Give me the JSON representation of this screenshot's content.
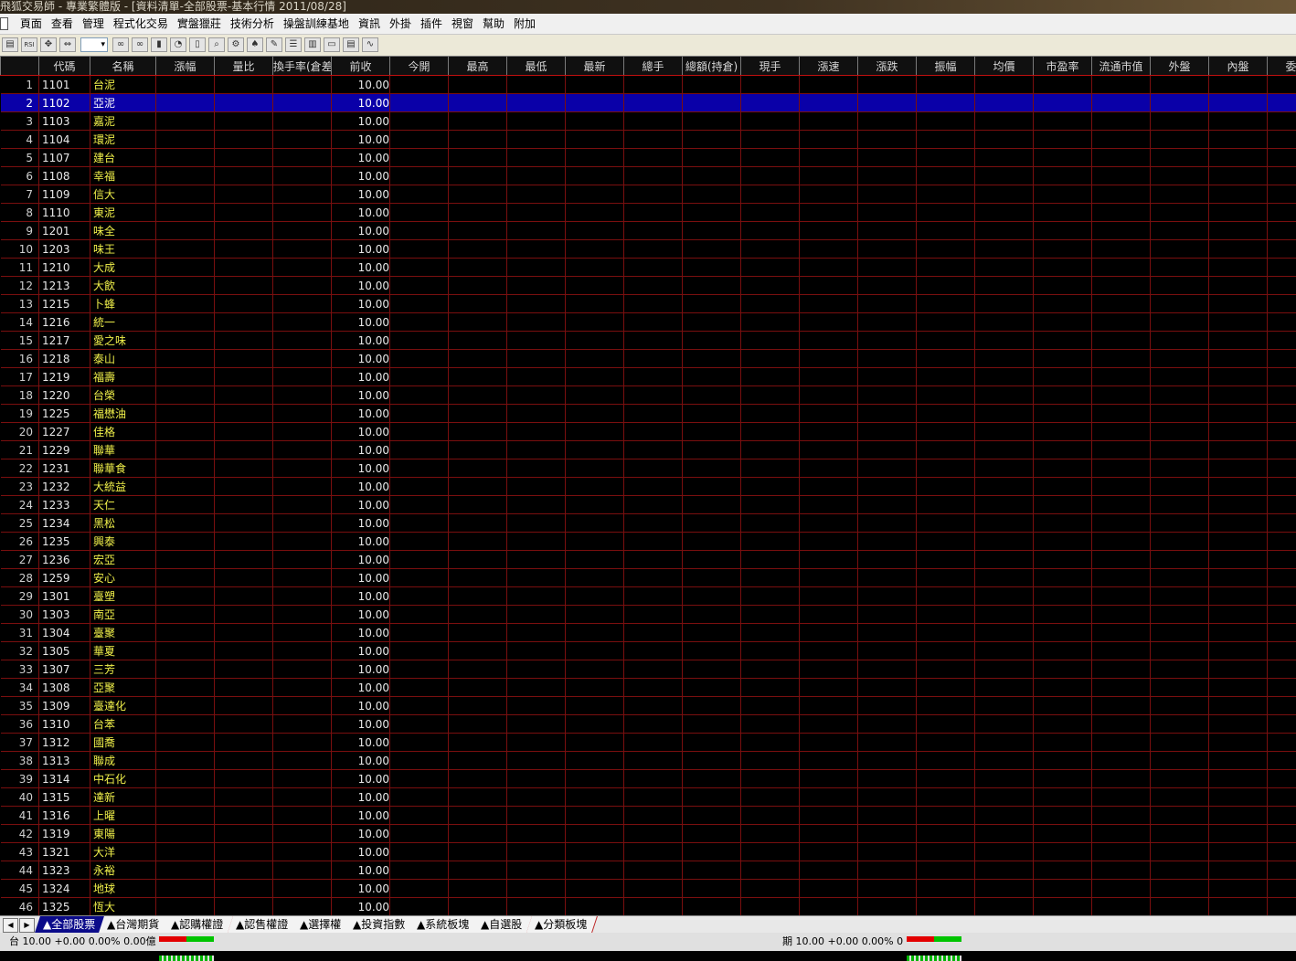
{
  "window": {
    "title": "飛狐交易師 - 專業繁體版 - [資料清單-全部股票-基本行情 2011/08/28]"
  },
  "menu": [
    "頁面",
    "查看",
    "管理",
    "程式化交易",
    "實盤獵莊",
    "技術分析",
    "操盤訓練基地",
    "資訊",
    "外掛",
    "插件",
    "視窗",
    "幫助",
    "附加"
  ],
  "toolbar": {
    "icons": [
      "folder-icon",
      "rsi-icon",
      "move-icon",
      "resize-icon",
      "binoculars-icon",
      "binoculars-2-icon",
      "bar-chart-icon",
      "pie-chart-icon",
      "book-icon",
      "search-icon",
      "gear-icon",
      "alarm-icon",
      "pen-icon",
      "layout-rows-icon",
      "layout-cols-icon",
      "window-icon",
      "list-window-icon",
      "graph-window-icon"
    ],
    "rsi_label": "RSI"
  },
  "table": {
    "columns": [
      "",
      "代碼",
      "名稱",
      "漲幅",
      "量比",
      "換手率(倉差)",
      "前收",
      "今開",
      "最高",
      "最低",
      "最新",
      "總手",
      "總額(持倉)",
      "現手",
      "漲速",
      "漲跌",
      "振幅",
      "均價",
      "市盈率",
      "流通市值",
      "外盤",
      "內盤",
      "委買"
    ],
    "selected_row": 2,
    "rows": [
      {
        "n": "1",
        "code": "1101",
        "name": "台泥",
        "prev": "10.00"
      },
      {
        "n": "2",
        "code": "1102",
        "name": "亞泥",
        "prev": "10.00"
      },
      {
        "n": "3",
        "code": "1103",
        "name": "嘉泥",
        "prev": "10.00"
      },
      {
        "n": "4",
        "code": "1104",
        "name": "環泥",
        "prev": "10.00"
      },
      {
        "n": "5",
        "code": "1107",
        "name": "建台",
        "prev": "10.00"
      },
      {
        "n": "6",
        "code": "1108",
        "name": "幸福",
        "prev": "10.00"
      },
      {
        "n": "7",
        "code": "1109",
        "name": "信大",
        "prev": "10.00"
      },
      {
        "n": "8",
        "code": "1110",
        "name": "東泥",
        "prev": "10.00"
      },
      {
        "n": "9",
        "code": "1201",
        "name": "味全",
        "prev": "10.00"
      },
      {
        "n": "10",
        "code": "1203",
        "name": "味王",
        "prev": "10.00"
      },
      {
        "n": "11",
        "code": "1210",
        "name": "大成",
        "prev": "10.00"
      },
      {
        "n": "12",
        "code": "1213",
        "name": "大飲",
        "prev": "10.00"
      },
      {
        "n": "13",
        "code": "1215",
        "name": "卜蜂",
        "prev": "10.00"
      },
      {
        "n": "14",
        "code": "1216",
        "name": "統一",
        "prev": "10.00"
      },
      {
        "n": "15",
        "code": "1217",
        "name": "愛之味",
        "prev": "10.00"
      },
      {
        "n": "16",
        "code": "1218",
        "name": "泰山",
        "prev": "10.00"
      },
      {
        "n": "17",
        "code": "1219",
        "name": "福壽",
        "prev": "10.00"
      },
      {
        "n": "18",
        "code": "1220",
        "name": "台榮",
        "prev": "10.00"
      },
      {
        "n": "19",
        "code": "1225",
        "name": "福懋油",
        "prev": "10.00"
      },
      {
        "n": "20",
        "code": "1227",
        "name": "佳格",
        "prev": "10.00"
      },
      {
        "n": "21",
        "code": "1229",
        "name": "聯華",
        "prev": "10.00"
      },
      {
        "n": "22",
        "code": "1231",
        "name": "聯華食",
        "prev": "10.00"
      },
      {
        "n": "23",
        "code": "1232",
        "name": "大統益",
        "prev": "10.00"
      },
      {
        "n": "24",
        "code": "1233",
        "name": "天仁",
        "prev": "10.00"
      },
      {
        "n": "25",
        "code": "1234",
        "name": "黑松",
        "prev": "10.00"
      },
      {
        "n": "26",
        "code": "1235",
        "name": "興泰",
        "prev": "10.00"
      },
      {
        "n": "27",
        "code": "1236",
        "name": "宏亞",
        "prev": "10.00"
      },
      {
        "n": "28",
        "code": "1259",
        "name": "安心",
        "prev": "10.00"
      },
      {
        "n": "29",
        "code": "1301",
        "name": "臺塑",
        "prev": "10.00"
      },
      {
        "n": "30",
        "code": "1303",
        "name": "南亞",
        "prev": "10.00"
      },
      {
        "n": "31",
        "code": "1304",
        "name": "臺聚",
        "prev": "10.00"
      },
      {
        "n": "32",
        "code": "1305",
        "name": "華夏",
        "prev": "10.00"
      },
      {
        "n": "33",
        "code": "1307",
        "name": "三芳",
        "prev": "10.00"
      },
      {
        "n": "34",
        "code": "1308",
        "name": "亞聚",
        "prev": "10.00"
      },
      {
        "n": "35",
        "code": "1309",
        "name": "臺達化",
        "prev": "10.00"
      },
      {
        "n": "36",
        "code": "1310",
        "name": "台苯",
        "prev": "10.00"
      },
      {
        "n": "37",
        "code": "1312",
        "name": "國喬",
        "prev": "10.00"
      },
      {
        "n": "38",
        "code": "1313",
        "name": "聯成",
        "prev": "10.00"
      },
      {
        "n": "39",
        "code": "1314",
        "name": "中石化",
        "prev": "10.00"
      },
      {
        "n": "40",
        "code": "1315",
        "name": "達新",
        "prev": "10.00"
      },
      {
        "n": "41",
        "code": "1316",
        "name": "上曜",
        "prev": "10.00"
      },
      {
        "n": "42",
        "code": "1319",
        "name": "東陽",
        "prev": "10.00"
      },
      {
        "n": "43",
        "code": "1321",
        "name": "大洋",
        "prev": "10.00"
      },
      {
        "n": "44",
        "code": "1323",
        "name": "永裕",
        "prev": "10.00"
      },
      {
        "n": "45",
        "code": "1324",
        "name": "地球",
        "prev": "10.00"
      },
      {
        "n": "46",
        "code": "1325",
        "name": "恆大",
        "prev": "10.00"
      }
    ]
  },
  "tabs": {
    "nav_prev": "◀",
    "nav_next": "▶",
    "items": [
      "▲全部股票",
      "▲台灣期貨",
      "▲認購權證",
      "▲認售權證",
      "▲選擇權",
      "▲投資指數",
      "▲系統板塊",
      "▲自選股",
      "▲分類板塊"
    ],
    "active": 0
  },
  "status": {
    "left_text": "台 10.00 +0.00 0.00% 0.00億",
    "right_text": "期 10.00 +0.00 0.00% 0",
    "up_color": "#e30000",
    "down_color": "#00c400"
  }
}
